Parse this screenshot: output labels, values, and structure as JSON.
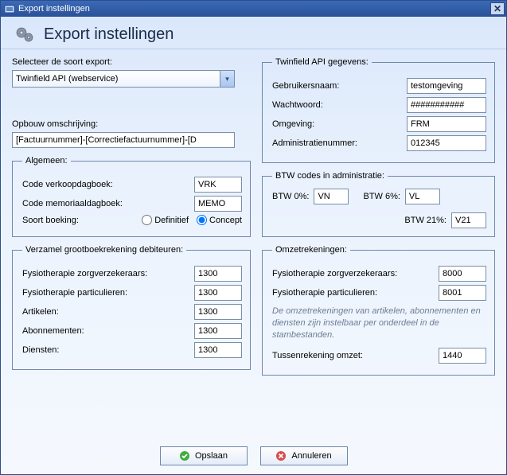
{
  "titlebar": {
    "title": "Export instellingen"
  },
  "header": {
    "title": "Export instellingen"
  },
  "export_type": {
    "label": "Selecteer de soort export:",
    "value": "Twinfield API (webservice)"
  },
  "opbouw": {
    "label": "Opbouw omschrijving:",
    "value": "[Factuurnummer]-[Correctiefactuurnummer]-[D"
  },
  "algemeen": {
    "legend": "Algemeen:",
    "code_verkoop_label": "Code verkoopdagboek:",
    "code_verkoop_value": "VRK",
    "code_memoriaal_label": "Code memoriaaldagboek:",
    "code_memoriaal_value": "MEMO",
    "soort_boeking_label": "Soort boeking:",
    "definitief_label": "Definitief",
    "concept_label": "Concept",
    "selected": "concept"
  },
  "verzamel": {
    "legend": "Verzamel grootboekrekening debiteuren:",
    "rows": [
      {
        "label": "Fysiotherapie zorgverzekeraars:",
        "value": "1300"
      },
      {
        "label": "Fysiotherapie particulieren:",
        "value": "1300"
      },
      {
        "label": "Artikelen:",
        "value": "1300"
      },
      {
        "label": "Abonnementen:",
        "value": "1300"
      },
      {
        "label": "Diensten:",
        "value": "1300"
      }
    ]
  },
  "twinfield": {
    "legend": "Twinfield API gegevens:",
    "gebruikersnaam_label": "Gebruikersnaam:",
    "gebruikersnaam_value": "testomgeving",
    "wachtwoord_label": "Wachtwoord:",
    "wachtwoord_value": "###########",
    "omgeving_label": "Omgeving:",
    "omgeving_value": "FRM",
    "admin_label": "Administratienummer:",
    "admin_value": "012345"
  },
  "btw": {
    "legend": "BTW codes in administratie:",
    "p0_label": "BTW 0%:",
    "p0_value": "VN",
    "p6_label": "BTW 6%:",
    "p6_value": "VL",
    "p21_label": "BTW 21%:",
    "p21_value": "V21"
  },
  "omzet": {
    "legend": "Omzetrekeningen:",
    "fysio_zorg_label": "Fysiotherapie zorgverzekeraars:",
    "fysio_zorg_value": "8000",
    "fysio_part_label": "Fysiotherapie particulieren:",
    "fysio_part_value": "8001",
    "note": "De omzetrekeningen van artikelen, abonnementen en diensten zijn instelbaar per onderdeel in de stambestanden.",
    "tussen_label": "Tussenrekening omzet:",
    "tussen_value": "1440"
  },
  "footer": {
    "save": "Opslaan",
    "cancel": "Annuleren"
  }
}
